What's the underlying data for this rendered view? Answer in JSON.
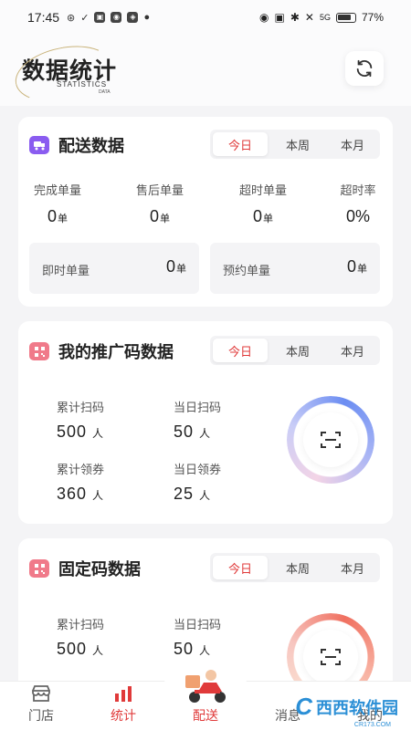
{
  "status_bar": {
    "time": "17:45",
    "battery": "77%",
    "network": "5G"
  },
  "header": {
    "logo_title": "数据统计",
    "logo_sub": "STATISTICS",
    "logo_sub2": "DATA"
  },
  "tabs": [
    "今日",
    "本周",
    "本月"
  ],
  "delivery": {
    "title": "配送数据",
    "stats": [
      {
        "label": "完成单量",
        "value": "0",
        "unit": "单"
      },
      {
        "label": "售后单量",
        "value": "0",
        "unit": "单"
      },
      {
        "label": "超时单量",
        "value": "0",
        "unit": "单"
      },
      {
        "label": "超时率",
        "value": "0%",
        "unit": ""
      }
    ],
    "sub": [
      {
        "label": "即时单量",
        "value": "0",
        "unit": "单"
      },
      {
        "label": "预约单量",
        "value": "0",
        "unit": "单"
      }
    ]
  },
  "promo": {
    "title": "我的推广码数据",
    "stats": [
      {
        "label": "累计扫码",
        "value": "500",
        "unit": "人"
      },
      {
        "label": "当日扫码",
        "value": "50",
        "unit": "人"
      },
      {
        "label": "累计领券",
        "value": "360",
        "unit": "人"
      },
      {
        "label": "当日领券",
        "value": "25",
        "unit": "人"
      }
    ]
  },
  "fixed": {
    "title": "固定码数据",
    "stats": [
      {
        "label": "累计扫码",
        "value": "500",
        "unit": "人"
      },
      {
        "label": "当日扫码",
        "value": "50",
        "unit": "人"
      },
      {
        "label": "累计领券",
        "value": "",
        "unit": ""
      }
    ]
  },
  "nav": {
    "store": "门店",
    "stats": "统计",
    "delivery": "配送",
    "message": "消息",
    "mine": "我的"
  },
  "watermark": {
    "text": "西西软件园",
    "sub": "CR173.COM"
  },
  "colors": {
    "accent": "#e03a3a",
    "delivery_icon": "#8a5cf0",
    "promo_icon": "#f07a8a"
  }
}
